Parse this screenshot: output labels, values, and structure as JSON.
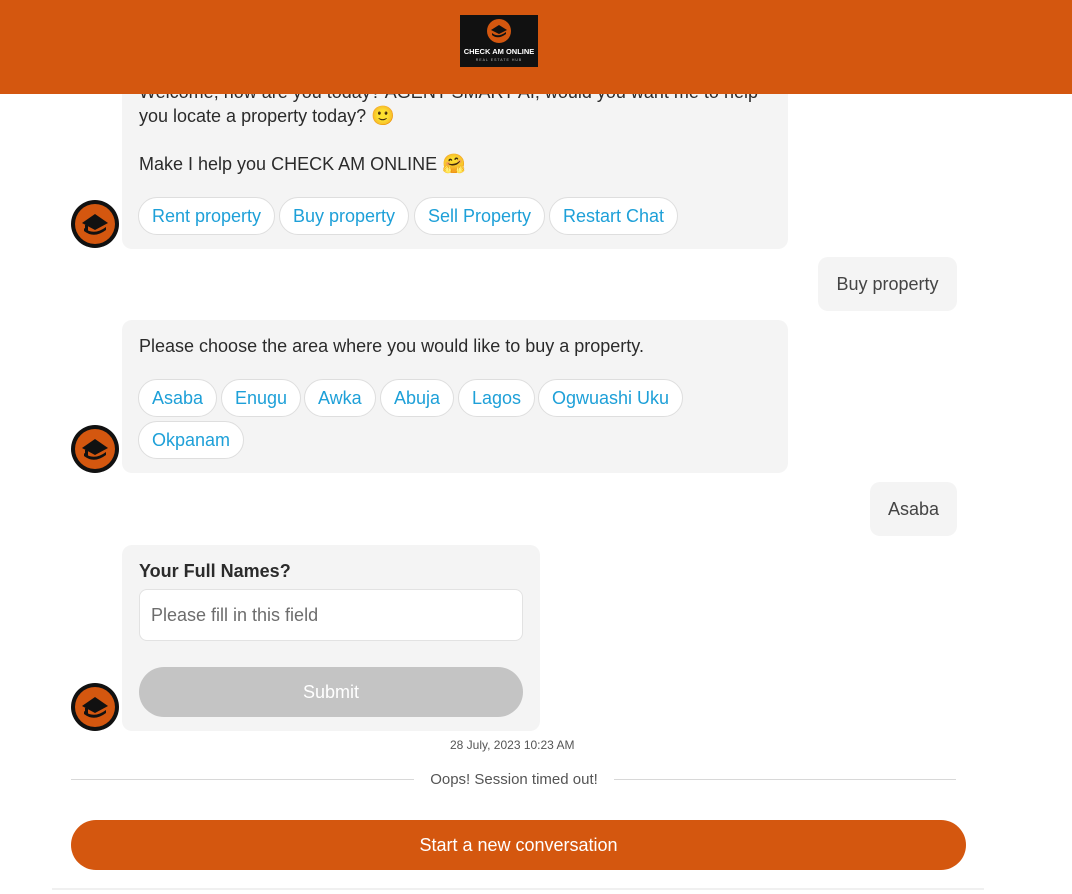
{
  "header": {
    "logo_title": "CHECK AM ONLINE",
    "logo_subtitle": "REAL ESTATE HUB",
    "brand_color": "#d4570f"
  },
  "messages": {
    "welcome": {
      "line1": "Welcome, how are you today? AGENT SMART AI, would you want me to help",
      "line2": "you locate a property today?",
      "line2_emoji": "🙂",
      "line3": "Make I help you CHECK AM ONLINE",
      "line3_emoji": "🤗",
      "chips": [
        "Rent property",
        "Buy property",
        "Sell Property",
        "Restart Chat"
      ]
    },
    "user_reply_1": "Buy property",
    "area_prompt": {
      "text": "Please choose the area where you would like to buy a property.",
      "chips": [
        "Asaba",
        "Enugu",
        "Awka",
        "Abuja",
        "Lagos",
        "Ogwuashi Uku",
        "Okpanam"
      ]
    },
    "user_reply_2": "Asaba",
    "form": {
      "label": "Your Full Names?",
      "placeholder": "Please fill in this field",
      "submit_label": "Submit"
    }
  },
  "footer": {
    "timestamp": "28 July, 2023 10:23 AM",
    "session_status": "Oops! Session timed out!",
    "new_conversation_label": "Start a new conversation"
  },
  "icons": {
    "avatar": "house-hand-icon",
    "logo": "house-hand-logo-icon"
  },
  "colors": {
    "accent": "#d4570f",
    "chip_text": "#1ea0d8",
    "bubble_bg": "#f4f4f4",
    "submit_disabled": "#c4c4c4"
  }
}
